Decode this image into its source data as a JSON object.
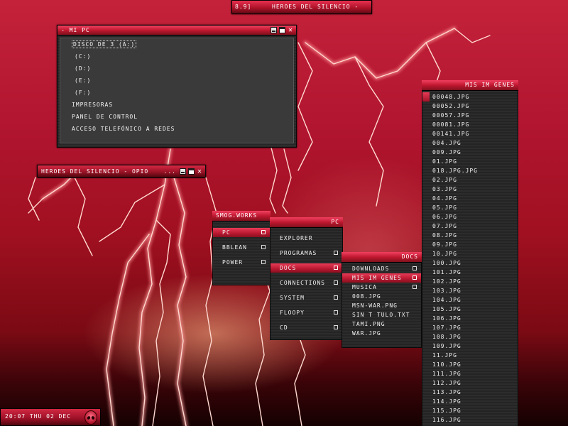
{
  "topbar": {
    "left": "8.9]",
    "track": "HEROES DEL SILENCIO -"
  },
  "mipc": {
    "title": "- MI PC",
    "items": [
      "DISCO DE 3 (A:)",
      "(C:)",
      "(D:)",
      "(E:)",
      "(F:)",
      "IMPRESORAS",
      "PANEL DE CONTROL",
      "ACCESO TELEFÓNICO A REDES"
    ]
  },
  "heroes": {
    "title": "HEROES DEL SILENCIO - OPIO",
    "ellipsis": "..."
  },
  "menus": {
    "smog": {
      "title": "SMOG.WORKS",
      "items": [
        "PC",
        "BBLEAN",
        "POWER"
      ]
    },
    "pc": {
      "title": "PC",
      "items": [
        "EXPLORER",
        "PROGRAMAS",
        "DOCS",
        "CONNECTIONS",
        "SYSTEM",
        "FLOOPY",
        "CD"
      ]
    },
    "docs": {
      "title": "DOCS",
      "items": [
        "DOWNLOADS",
        "MIS IM GENES",
        "MUSICA",
        "008.JPG",
        "MSN-WAR.PNG",
        "SIN T TULO.TXT",
        "TAMI.PNG",
        "WAR.JPG"
      ]
    },
    "images": {
      "title": "MIS IM GENES",
      "items": [
        "00048.JPG",
        "00052.JPG",
        "00057.JPG",
        "00081.JPG",
        "00141.JPG",
        "004.JPG",
        "009.JPG",
        "01.JPG",
        "018.JPG.JPG",
        "02.JPG",
        "03.JPG",
        "04.JPG",
        "05.JPG",
        "06.JPG",
        "07.JPG",
        "08.JPG",
        "09.JPG",
        "10.JPG",
        "100.JPG",
        "101.JPG",
        "102.JPG",
        "103.JPG",
        "104.JPG",
        "105.JPG",
        "106.JPG",
        "107.JPG",
        "108.JPG",
        "109.JPG",
        "11.JPG",
        "110.JPG",
        "111.JPG",
        "112.JPG",
        "113.JPG",
        "114.JPG",
        "115.JPG",
        "116.JPG"
      ]
    }
  },
  "clock": {
    "text": "20:07 THU 02 DEC"
  },
  "colors": {
    "accent": "#c01830",
    "panel": "#2c2c2c",
    "highlight": "#e83a56"
  }
}
